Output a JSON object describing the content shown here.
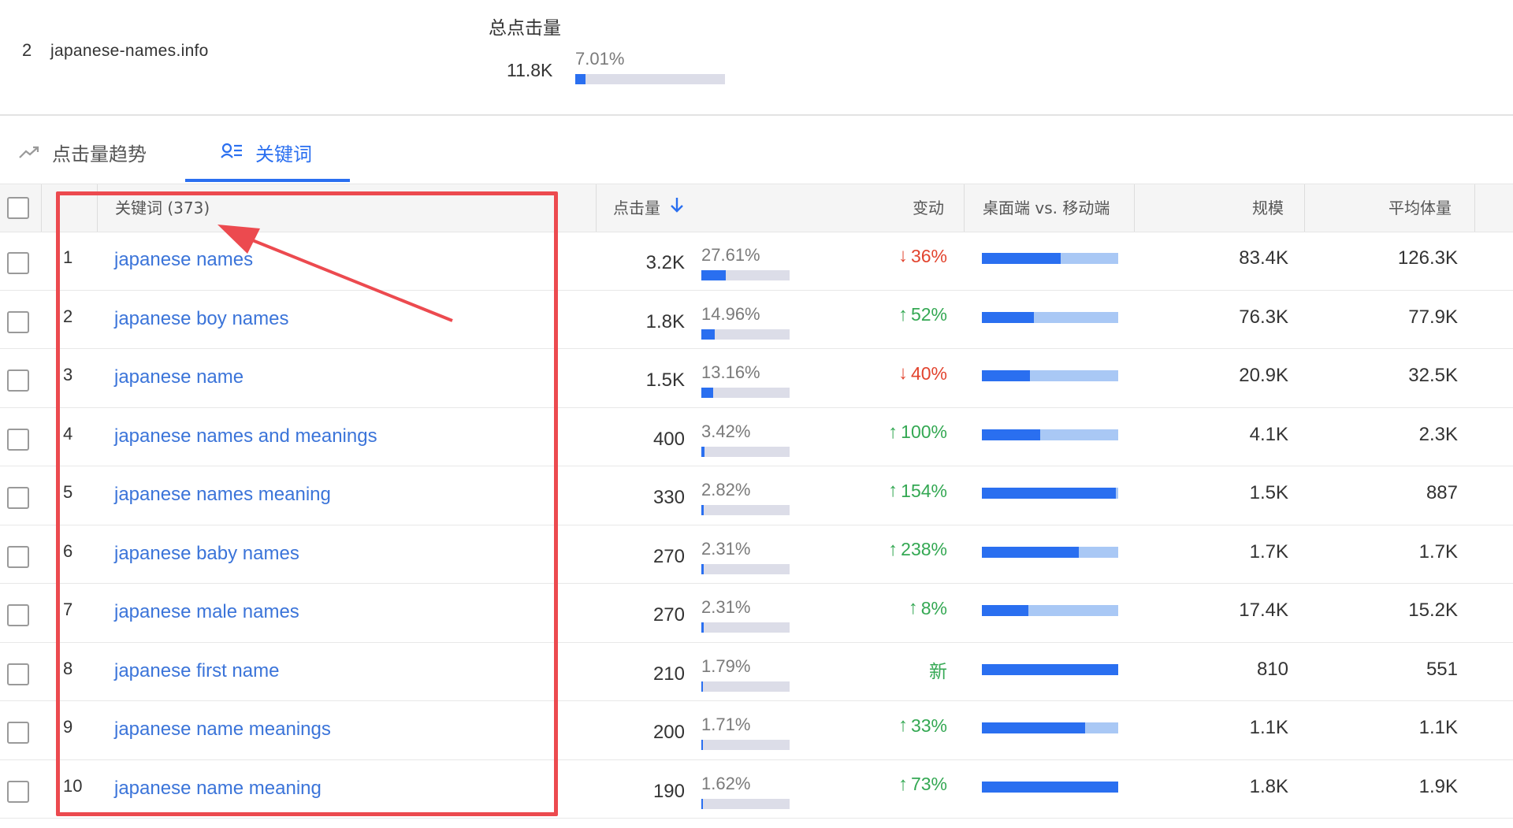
{
  "site": {
    "index": "2",
    "domain": "japanese-names.info",
    "total_clicks_title": "总点击量",
    "total_clicks_value": "11.8K",
    "total_clicks_pct": "7.01%",
    "total_clicks_share": 0.0701
  },
  "tabs": {
    "trend_label": "点击量趋势",
    "keywords_label": "关键词",
    "active": "keywords"
  },
  "table": {
    "headers": {
      "keyword": "关键词 (373)",
      "clicks": "点击量",
      "change": "变动",
      "device": "桌面端 vs. 移动端",
      "scale": "规模",
      "avg_volume": "平均体量"
    },
    "sort": {
      "column": "clicks",
      "direction": "desc"
    },
    "rows": [
      {
        "idx": "1",
        "keyword": "japanese names",
        "clicks": "3.2K",
        "pct": "27.61%",
        "share": 0.2761,
        "change": "36%",
        "dir": "down",
        "desktop": 0.58,
        "scale": "83.4K",
        "avg": "126.3K"
      },
      {
        "idx": "2",
        "keyword": "japanese boy names",
        "clicks": "1.8K",
        "pct": "14.96%",
        "share": 0.1496,
        "change": "52%",
        "dir": "up",
        "desktop": 0.38,
        "scale": "76.3K",
        "avg": "77.9K"
      },
      {
        "idx": "3",
        "keyword": "japanese name",
        "clicks": "1.5K",
        "pct": "13.16%",
        "share": 0.1316,
        "change": "40%",
        "dir": "down",
        "desktop": 0.35,
        "scale": "20.9K",
        "avg": "32.5K"
      },
      {
        "idx": "4",
        "keyword": "japanese names and meanings",
        "clicks": "400",
        "pct": "3.42%",
        "share": 0.0342,
        "change": "100%",
        "dir": "up",
        "desktop": 0.43,
        "scale": "4.1K",
        "avg": "2.3K"
      },
      {
        "idx": "5",
        "keyword": "japanese names meaning",
        "clicks": "330",
        "pct": "2.82%",
        "share": 0.0282,
        "change": "154%",
        "dir": "up",
        "desktop": 0.98,
        "scale": "1.5K",
        "avg": "887"
      },
      {
        "idx": "6",
        "keyword": "japanese baby names",
        "clicks": "270",
        "pct": "2.31%",
        "share": 0.0231,
        "change": "238%",
        "dir": "up",
        "desktop": 0.71,
        "scale": "1.7K",
        "avg": "1.7K"
      },
      {
        "idx": "7",
        "keyword": "japanese male names",
        "clicks": "270",
        "pct": "2.31%",
        "share": 0.0231,
        "change": "8%",
        "dir": "up",
        "desktop": 0.34,
        "scale": "17.4K",
        "avg": "15.2K"
      },
      {
        "idx": "8",
        "keyword": "japanese first name",
        "clicks": "210",
        "pct": "1.79%",
        "share": 0.0179,
        "change": "新",
        "dir": "new",
        "desktop": 1.0,
        "scale": "810",
        "avg": "551"
      },
      {
        "idx": "9",
        "keyword": "japanese name meanings",
        "clicks": "200",
        "pct": "1.71%",
        "share": 0.0171,
        "change": "33%",
        "dir": "up",
        "desktop": 0.76,
        "scale": "1.1K",
        "avg": "1.1K"
      },
      {
        "idx": "10",
        "keyword": "japanese name meaning",
        "clicks": "190",
        "pct": "1.62%",
        "share": 0.0162,
        "change": "73%",
        "dir": "up",
        "desktop": 1.0,
        "scale": "1.8K",
        "avg": "1.9K"
      }
    ]
  },
  "colors": {
    "accent": "#2a6ff0",
    "link": "#3b74d9",
    "up": "#34a853",
    "down": "#e2442f",
    "mobile": "#a9c8f5",
    "annotation": "#ec4a4f"
  },
  "icons": {
    "trend_tab": "trend-line-icon",
    "keywords_tab": "keyword-list-icon",
    "sort": "arrow-down-icon",
    "up": "arrow-up-icon",
    "down": "arrow-down-icon"
  }
}
